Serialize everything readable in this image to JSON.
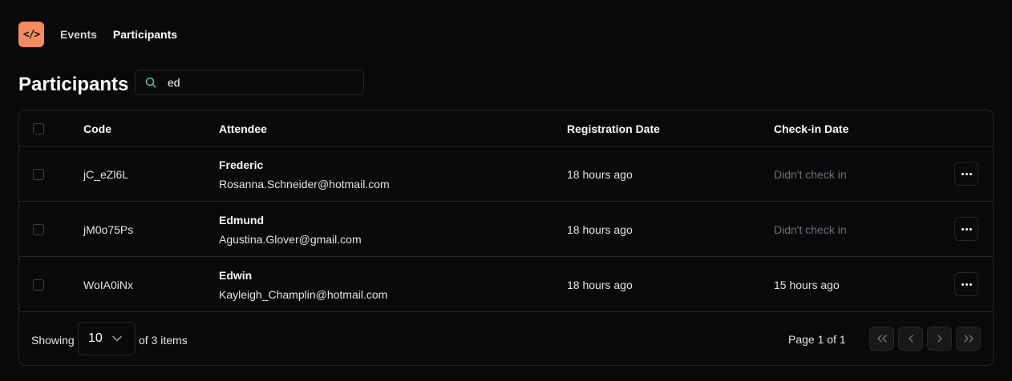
{
  "nav": {
    "logo": "</>",
    "links": [
      "Events",
      "Participants"
    ]
  },
  "page": {
    "title": "Participants"
  },
  "search": {
    "value": "ed",
    "icon": "search-icon"
  },
  "table": {
    "columns": [
      "Code",
      "Attendee",
      "Registration Date",
      "Check-in Date"
    ],
    "rows": [
      {
        "code": "jC_eZl6L",
        "name": "Frederic",
        "email": "Rosanna.Schneider@hotmail.com",
        "registered": "18 hours ago",
        "checkin": "Didn't check in",
        "checked_in": false
      },
      {
        "code": "jM0o75Ps",
        "name": "Edmund",
        "email": "Agustina.Glover@gmail.com",
        "registered": "18 hours ago",
        "checkin": "Didn't check in",
        "checked_in": false
      },
      {
        "code": "WoIA0iNx",
        "name": "Edwin",
        "email": "Kayleigh_Champlin@hotmail.com",
        "registered": "18 hours ago",
        "checkin": "15 hours ago",
        "checked_in": true
      }
    ]
  },
  "footer": {
    "showing_label": "Showing",
    "page_size": "10",
    "items_label": "of 3 items",
    "page_label": "Page 1 of 1"
  },
  "colors": {
    "background": "#09090b",
    "accent": "#f38c5e",
    "border": "#27272a",
    "muted_text": "#71717a",
    "search_icon": "#5ec2a0"
  }
}
